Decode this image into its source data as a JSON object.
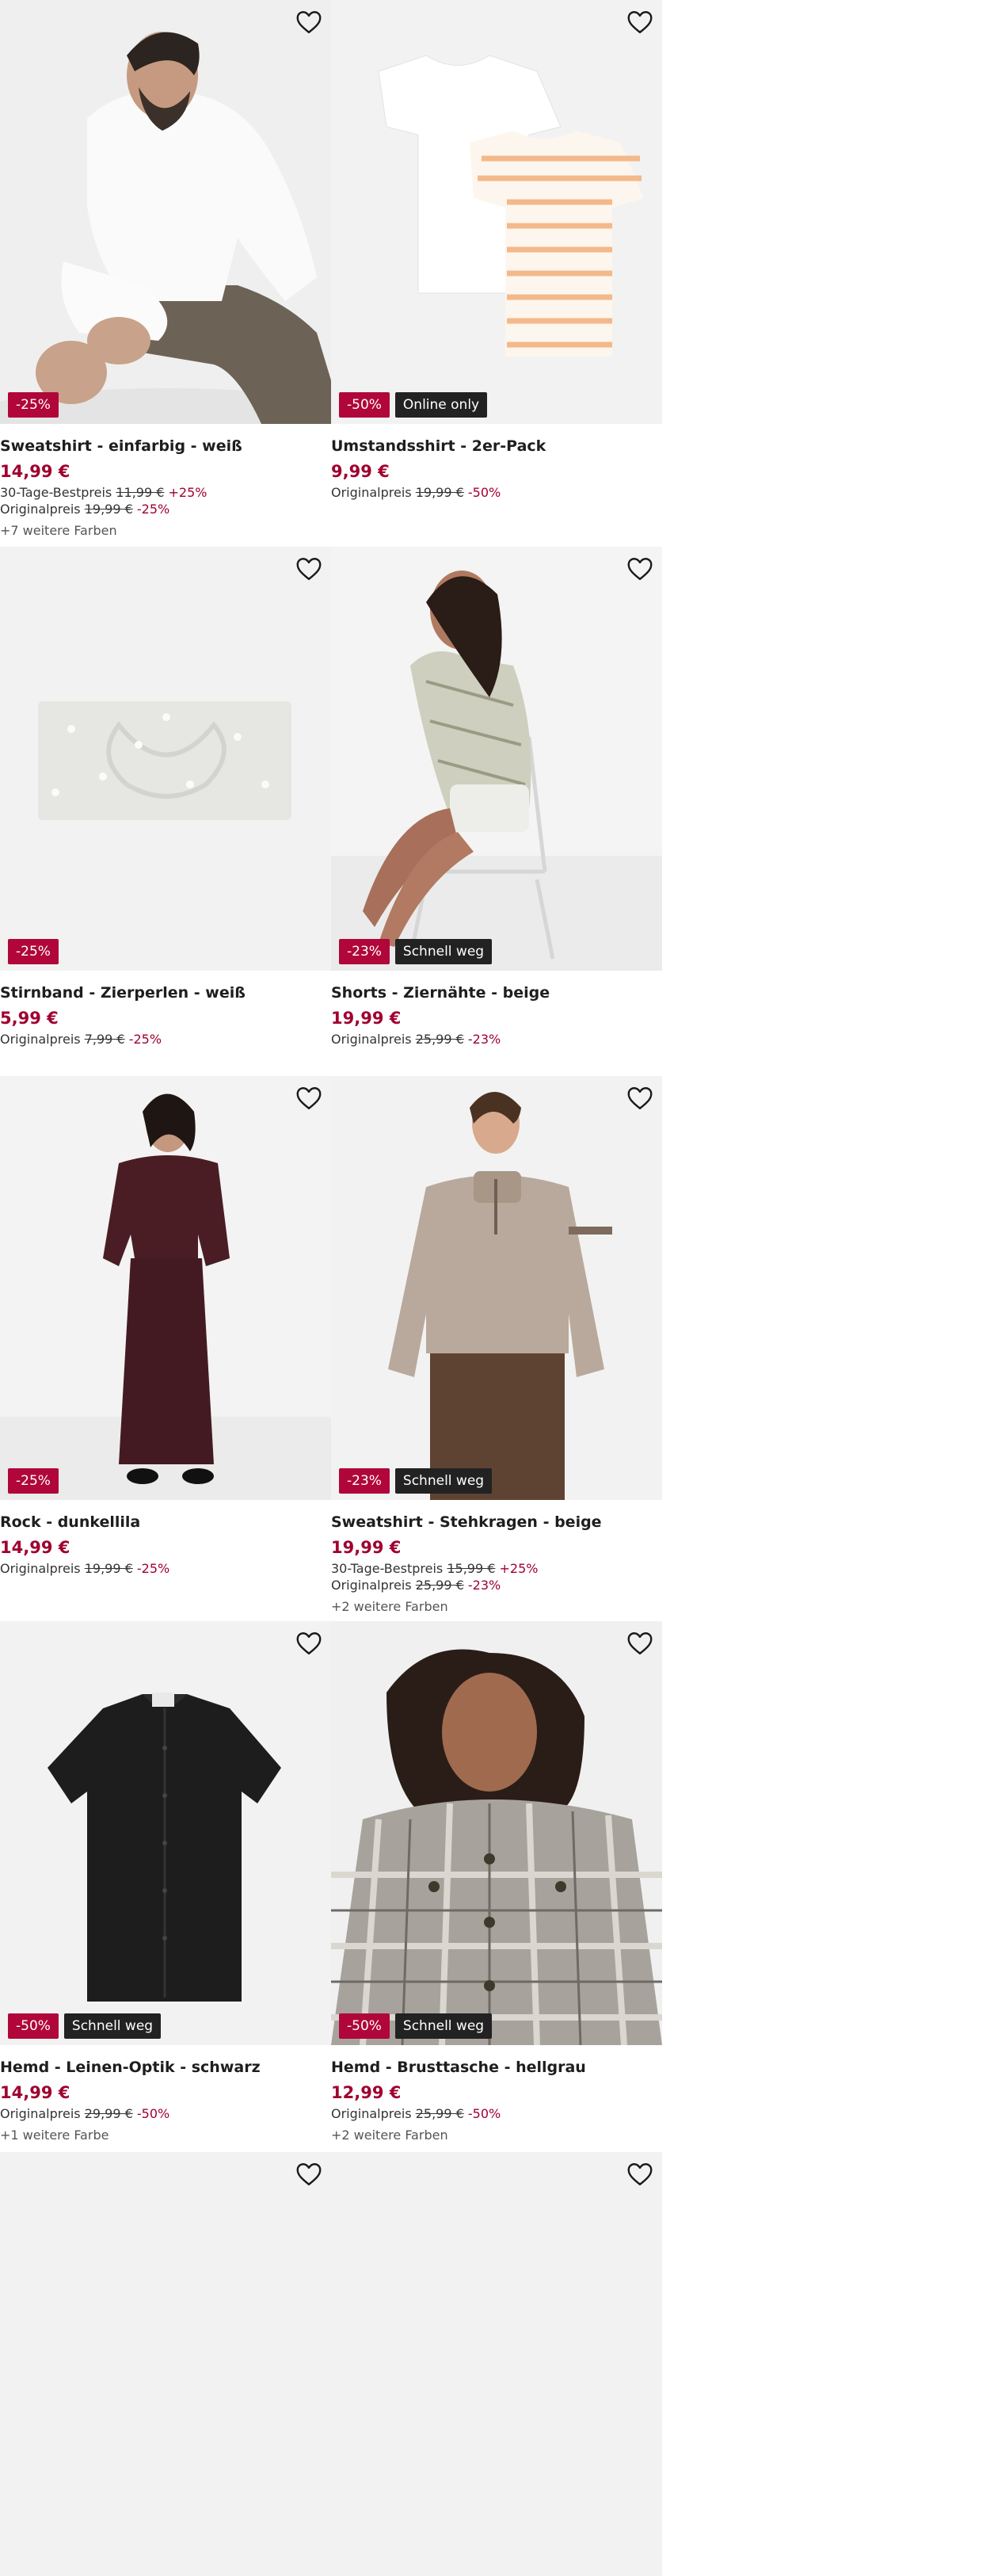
{
  "products": [
    {
      "name": "Sweatshirt - einfarbig - weiß",
      "price": "14,99 €",
      "lines": [
        {
          "label": "30-Tage-Bestpreis",
          "old": "11,99 €",
          "pct": "+25%"
        },
        {
          "label": "Originalpreis",
          "old": "19,99 €",
          "pct": "-25%"
        }
      ],
      "badges": [
        {
          "text": "-25%",
          "kind": "sale"
        }
      ],
      "colors": "+7 weitere Farben"
    },
    {
      "name": "Umstandsshirt - 2er-Pack",
      "price": "9,99 €",
      "lines": [
        {
          "label": "Originalpreis",
          "old": "19,99 €",
          "pct": "-50%"
        }
      ],
      "badges": [
        {
          "text": "-50%",
          "kind": "sale"
        },
        {
          "text": "Online only",
          "kind": "dark"
        }
      ],
      "colors": ""
    },
    {
      "name": "Stirnband - Zierperlen - weiß",
      "price": "5,99 €",
      "lines": [
        {
          "label": "Originalpreis",
          "old": "7,99 €",
          "pct": "-25%"
        }
      ],
      "badges": [
        {
          "text": "-25%",
          "kind": "sale"
        }
      ],
      "colors": ""
    },
    {
      "name": "Shorts - Ziernähte - beige",
      "price": "19,99 €",
      "lines": [
        {
          "label": "Originalpreis",
          "old": "25,99 €",
          "pct": "-23%"
        }
      ],
      "badges": [
        {
          "text": "-23%",
          "kind": "sale"
        },
        {
          "text": "Schnell weg",
          "kind": "dark"
        }
      ],
      "colors": ""
    },
    {
      "name": "Rock - dunkellila",
      "price": "14,99 €",
      "lines": [
        {
          "label": "Originalpreis",
          "old": "19,99 €",
          "pct": "-25%"
        }
      ],
      "badges": [
        {
          "text": "-25%",
          "kind": "sale"
        }
      ],
      "colors": ""
    },
    {
      "name": "Sweatshirt - Stehkragen - beige",
      "price": "19,99 €",
      "lines": [
        {
          "label": "30-Tage-Bestpreis",
          "old": "15,99 €",
          "pct": "+25%"
        },
        {
          "label": "Originalpreis",
          "old": "25,99 €",
          "pct": "-23%"
        }
      ],
      "badges": [
        {
          "text": "-23%",
          "kind": "sale"
        },
        {
          "text": "Schnell weg",
          "kind": "dark"
        }
      ],
      "colors": "+2 weitere Farben"
    },
    {
      "name": "Hemd - Leinen-Optik - schwarz",
      "price": "14,99 €",
      "lines": [
        {
          "label": "Originalpreis",
          "old": "29,99 €",
          "pct": "-50%"
        }
      ],
      "badges": [
        {
          "text": "-50%",
          "kind": "sale"
        },
        {
          "text": "Schnell weg",
          "kind": "dark"
        }
      ],
      "colors": "+1 weitere Farbe"
    },
    {
      "name": "Hemd - Brusttasche - hellgrau",
      "price": "12,99 €",
      "lines": [
        {
          "label": "Originalpreis",
          "old": "25,99 €",
          "pct": "-50%"
        }
      ],
      "badges": [
        {
          "text": "-50%",
          "kind": "sale"
        },
        {
          "text": "Schnell weg",
          "kind": "dark"
        }
      ],
      "colors": "+2 weitere Farben"
    }
  ],
  "icons": {
    "wishlist": "heart-outline-icon"
  },
  "colors": {
    "sale": "#b0063a",
    "price": "#a0002f",
    "badge_dark": "#222222",
    "image_bg": "#f2f2f2"
  }
}
